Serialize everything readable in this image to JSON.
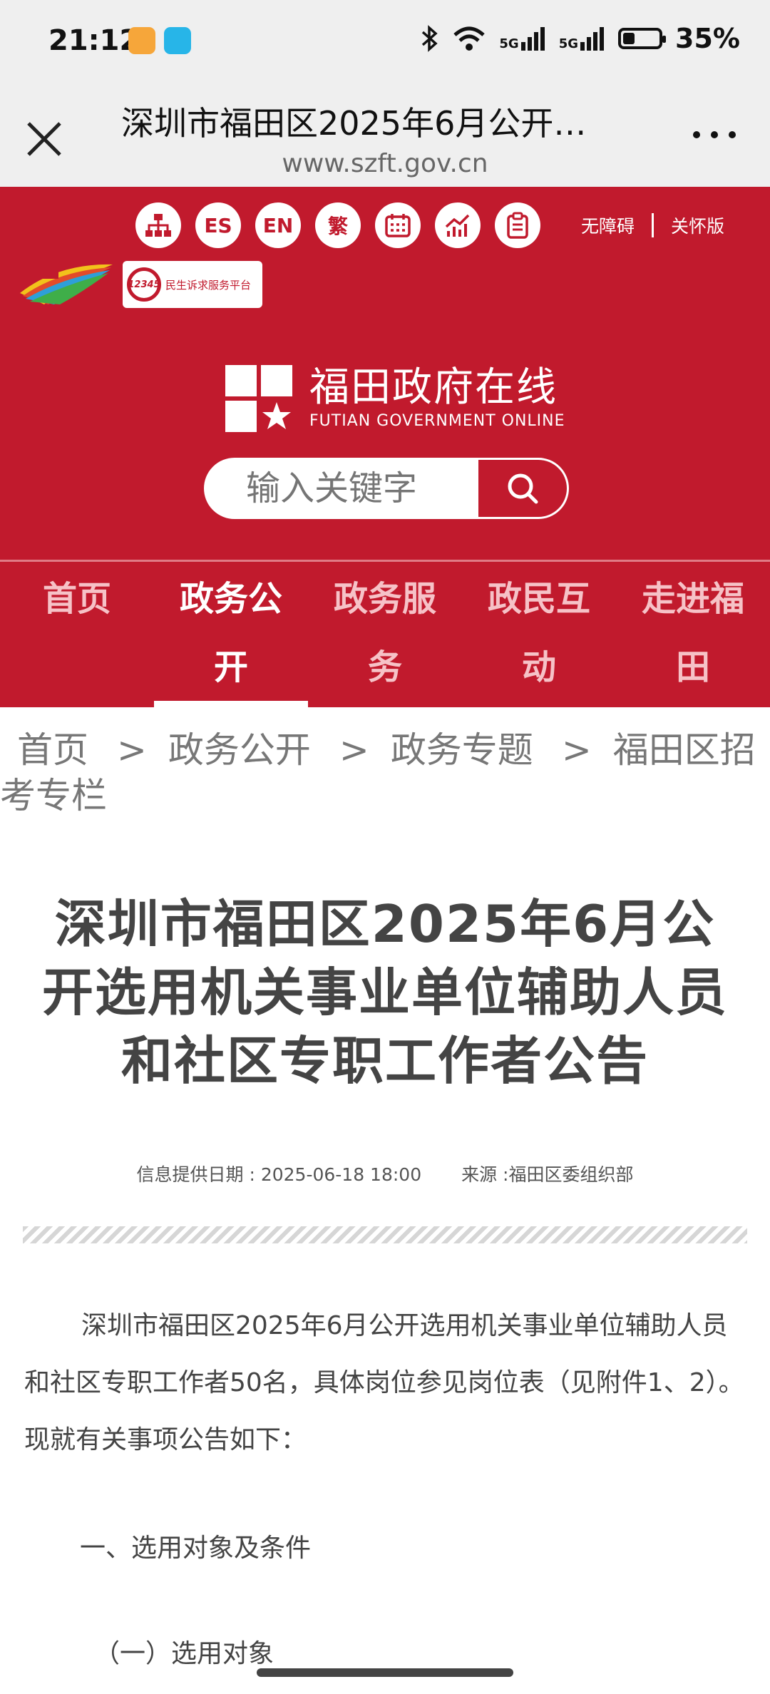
{
  "status_bar": {
    "time": "21:12",
    "signal1": "5G",
    "signal2": "5G",
    "battery": "35%",
    "icons": [
      "bluetooth-icon",
      "wifi-icon",
      "signal-5g-icon",
      "signal-5g-icon",
      "battery-icon"
    ]
  },
  "browser": {
    "title": "深圳市福田区2025年6月公开…",
    "url": "www.szft.gov.cn"
  },
  "header": {
    "tools": [
      {
        "label": "",
        "icon": "sitemap-icon"
      },
      {
        "label": "ES",
        "icon": "es-icon"
      },
      {
        "label": "EN",
        "icon": "en-icon"
      },
      {
        "label": "繁",
        "icon": "traditional-icon"
      },
      {
        "label": "",
        "icon": "calendar-icon"
      },
      {
        "label": "",
        "icon": "chart-icon"
      },
      {
        "label": "",
        "icon": "clipboard-icon"
      }
    ],
    "accessibility": "无障碍",
    "elder_mode": "关怀版",
    "badge_number": "12345",
    "badge_text": "民生诉求服务平台",
    "brand_cn": "福田政府在线",
    "brand_en": "FUTIAN GOVERNMENT ONLINE",
    "search_placeholder": "输入关键字",
    "colors": {
      "brand_red": "#c11a2d"
    }
  },
  "nav": {
    "items": [
      "首页",
      "政务公开",
      "政务服务",
      "政民互动",
      "走进福田"
    ],
    "active_index": 1,
    "lines": [
      [
        "首页",
        ""
      ],
      [
        "政务公",
        "开"
      ],
      [
        "政务服",
        "务"
      ],
      [
        "政民互",
        "动"
      ],
      [
        "走进福",
        "田"
      ]
    ]
  },
  "breadcrumb": {
    "items": [
      "首页",
      "政务公开",
      "政务专题",
      "福田区招考专栏"
    ],
    "separator": ">"
  },
  "article": {
    "title": "深圳市福田区2025年6月公开选用机关事业单位辅助人员和社区专职工作者公告",
    "date_label": "信息提供日期 : 2025-06-18 18:00",
    "source_label": "来源 :福田区委组织部",
    "para1": "深圳市福田区2025年6月公开选用机关事业单位辅助人员和社区专职工作者50名，具体岗位参见岗位表（见附件1、2）。现就有关事项公告如下：",
    "heading1": "一、选用对象及条件",
    "subheading1": "（一）选用对象"
  }
}
